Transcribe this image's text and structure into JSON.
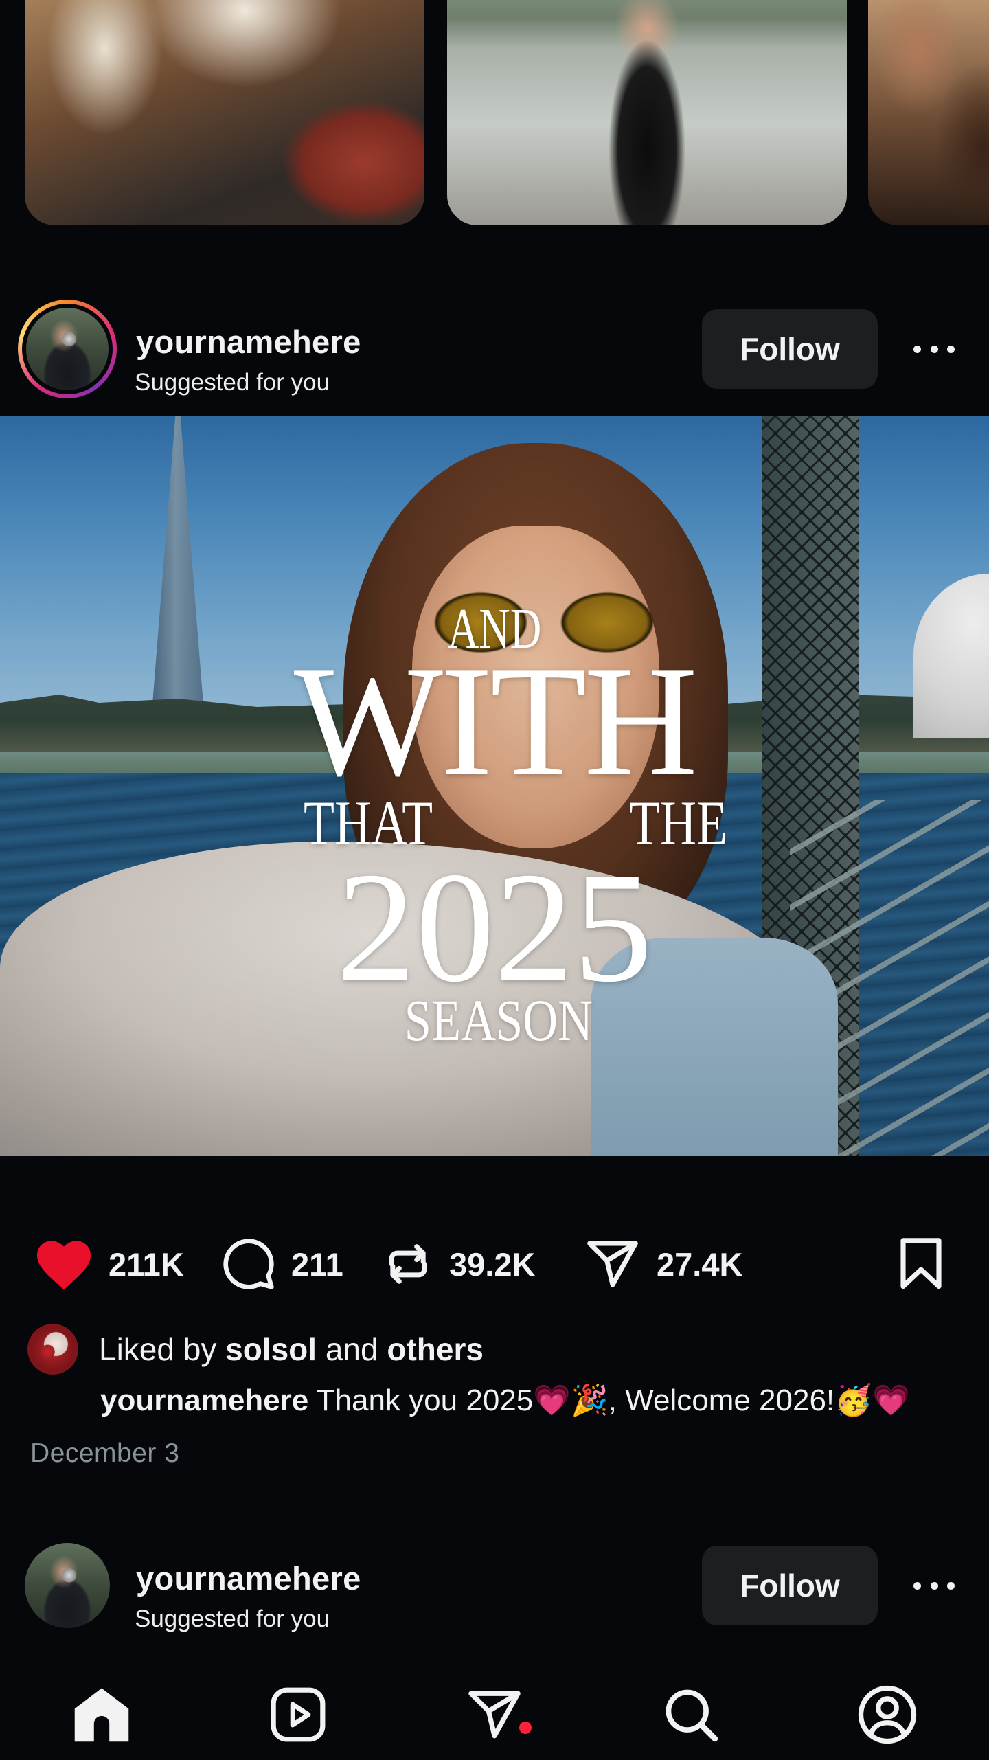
{
  "reels_strip": {
    "items": [
      "reel-thumbnail-1",
      "reel-thumbnail-2",
      "reel-thumbnail-3"
    ]
  },
  "post": {
    "username": "yournamehere",
    "subtitle": "Suggested for you",
    "follow_label": "Follow",
    "media_text": {
      "line1": "AND",
      "line2": "WITH",
      "line3a": "THAT",
      "line3b": "THE",
      "line4": "2025",
      "line5": "SEASON"
    },
    "actions": {
      "likes": "211K",
      "comments": "211",
      "reposts": "39.2K",
      "shares": "27.4K"
    },
    "liked_by": {
      "prefix": "Liked by",
      "user": "solsol",
      "connector": "and",
      "others": "others"
    },
    "caption": {
      "username": "yournamehere",
      "text": "Thank you 2025💗🎉, Welcome 2026!🥳💗"
    },
    "date": "December 3"
  },
  "next_post": {
    "username": "yournamehere",
    "subtitle": "Suggested for you",
    "follow_label": "Follow"
  },
  "bottom_nav": {
    "items": [
      "home-icon",
      "reels-icon",
      "direct-icon",
      "search-icon",
      "profile-icon"
    ],
    "notification_color": "#ff2236"
  },
  "colors": {
    "background": "#05070a",
    "like_red": "#e8102a",
    "follow_bg": "#1b1f22",
    "date_gray": "#8a9599"
  }
}
